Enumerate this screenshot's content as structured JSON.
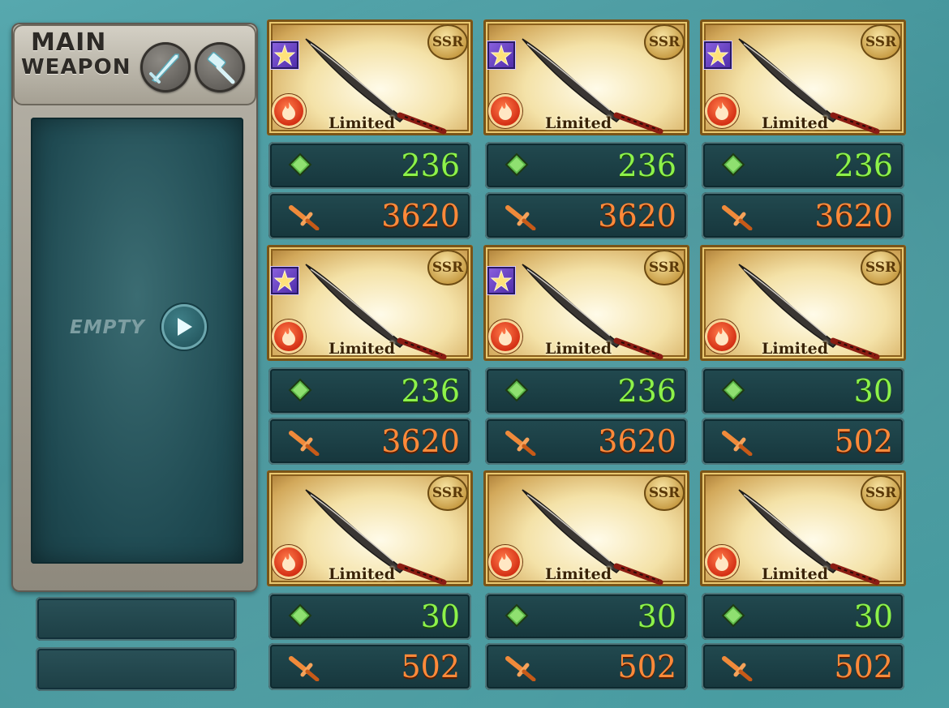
{
  "main_weapon": {
    "label_line1": "MAIN",
    "label_line2": "WEAPON",
    "empty_text": "EMPTY"
  },
  "weapons": [
    {
      "rarity": "SSR",
      "tag": "Limited",
      "hp": "236",
      "atk": "3620",
      "skill_icon": true
    },
    {
      "rarity": "SSR",
      "tag": "Limited",
      "hp": "236",
      "atk": "3620",
      "skill_icon": true
    },
    {
      "rarity": "SSR",
      "tag": "Limited",
      "hp": "236",
      "atk": "3620",
      "skill_icon": true
    },
    {
      "rarity": "SSR",
      "tag": "Limited",
      "hp": "236",
      "atk": "3620",
      "skill_icon": true
    },
    {
      "rarity": "SSR",
      "tag": "Limited",
      "hp": "236",
      "atk": "3620",
      "skill_icon": true
    },
    {
      "rarity": "SSR",
      "tag": "Limited",
      "hp": "30",
      "atk": "502",
      "skill_icon": false
    },
    {
      "rarity": "SSR",
      "tag": "Limited",
      "hp": "30",
      "atk": "502",
      "skill_icon": false
    },
    {
      "rarity": "SSR",
      "tag": "Limited",
      "hp": "30",
      "atk": "502",
      "skill_icon": false
    },
    {
      "rarity": "SSR",
      "tag": "Limited",
      "hp": "30",
      "atk": "502",
      "skill_icon": false
    }
  ],
  "colors": {
    "background": "#4a9ea3",
    "hp_text": "#8df24a",
    "atk_text": "#ff8a3a",
    "element_fire": "#d22c12",
    "skill_badge": "#6a44c8"
  }
}
